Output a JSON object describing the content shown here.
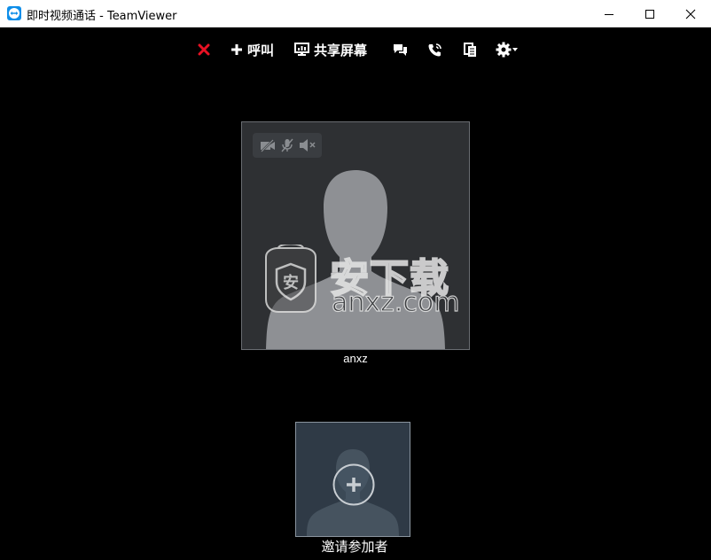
{
  "window": {
    "title": "即时视频通话 - TeamViewer"
  },
  "toolbar": {
    "end_call_icon": "close-x-red",
    "call_label": "呼叫",
    "share_screen_label": "共享屏幕",
    "chat_icon": "chat-icon",
    "phone_icon": "phone-icon",
    "files_icon": "files-icon",
    "settings_icon": "gear-icon"
  },
  "participant": {
    "name": "anxz"
  },
  "invite": {
    "label": "邀请参加者"
  },
  "watermark": {
    "text": "安下载",
    "url": "anxz.com",
    "shield_char": "安"
  },
  "colors": {
    "background": "#000000",
    "tile": "#2e3033",
    "invite_tile": "#2f3a46",
    "end_call": "#e81123",
    "teamviewer_blue": "#0e8ee9"
  }
}
